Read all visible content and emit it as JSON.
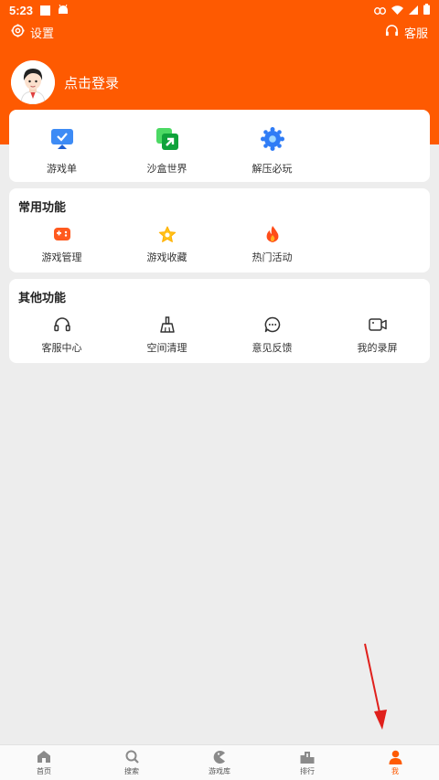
{
  "status_bar": {
    "time": "5:23"
  },
  "top_bar": {
    "settings_label": "设置",
    "service_label": "客服"
  },
  "profile": {
    "login_label": "点击登录"
  },
  "featured": {
    "items": [
      {
        "label": "游戏单",
        "icon": "game-list-icon"
      },
      {
        "label": "沙盒世界",
        "icon": "sandbox-world-icon"
      },
      {
        "label": "解压必玩",
        "icon": "relax-play-icon"
      }
    ]
  },
  "common": {
    "title": "常用功能",
    "items": [
      {
        "label": "游戏管理",
        "icon": "game-manage-icon"
      },
      {
        "label": "游戏收藏",
        "icon": "star-favorite-icon"
      },
      {
        "label": "热门活动",
        "icon": "flame-hot-icon"
      }
    ]
  },
  "other": {
    "title": "其他功能",
    "items": [
      {
        "label": "客服中心",
        "icon": "headset-icon"
      },
      {
        "label": "空间清理",
        "icon": "broom-clean-icon"
      },
      {
        "label": "意见反馈",
        "icon": "feedback-bubble-icon"
      },
      {
        "label": "我的录屏",
        "icon": "video-record-icon"
      }
    ]
  },
  "bottom_nav": {
    "items": [
      {
        "label": "首页",
        "icon": "home-icon"
      },
      {
        "label": "搜索",
        "icon": "search-icon"
      },
      {
        "label": "游戏库",
        "icon": "pacman-library-icon"
      },
      {
        "label": "排行",
        "icon": "ranking-podium-icon"
      },
      {
        "label": "我",
        "icon": "person-icon"
      }
    ],
    "active_index": 4
  },
  "colors": {
    "brand": "#fe5a01",
    "background": "#ededed",
    "annotation_arrow": "#e0201c"
  }
}
